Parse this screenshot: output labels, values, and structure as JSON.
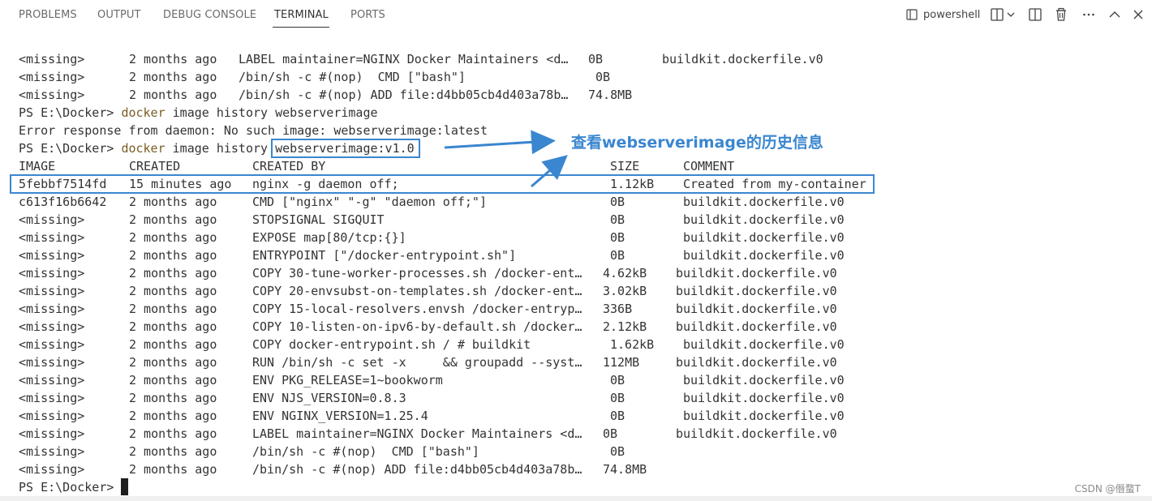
{
  "panel": {
    "tabs": [
      {
        "label": "PROBLEMS",
        "active": false
      },
      {
        "label": "OUTPUT",
        "active": false
      },
      {
        "label": "DEBUG CONSOLE",
        "active": false
      },
      {
        "label": "TERMINAL",
        "active": true
      },
      {
        "label": "PORTS",
        "active": false
      }
    ],
    "shell_label": "powershell",
    "icons": [
      "terminal-icon",
      "split-terminal-icon",
      "chevron-down-icon",
      "layout-icon",
      "trash-icon",
      "more-icon",
      "chevron-up-icon",
      "close-icon"
    ]
  },
  "terminal": {
    "lines": [
      {
        "image": "<missing>",
        "created": "2 months ago",
        "created_by": "LABEL maintainer=NGINX Docker Maintainers <d…",
        "size": "0B",
        "comment": "buildkit.dockerfile.v0"
      },
      {
        "image": "<missing>",
        "created": "2 months ago",
        "created_by": "/bin/sh -c #(nop)  CMD [\"bash\"]",
        "size": "0B",
        "comment": ""
      },
      {
        "image": "<missing>",
        "created": "2 months ago",
        "created_by": "/bin/sh -c #(nop) ADD file:d4bb05cb4d403a78b…",
        "size": "74.8MB",
        "comment": ""
      }
    ],
    "prompt1": "PS E:\\Docker> ",
    "command1": "docker image history webserverimage",
    "command1_parts": [
      "docker",
      " image history webserverimage"
    ],
    "error_line": "Error response from daemon: No such image: webserverimage:latest",
    "prompt2": "PS E:\\Docker> ",
    "command2_parts": [
      "docker",
      " image history ",
      "webserverimage:v1.0"
    ],
    "headers": {
      "image": "IMAGE",
      "created": "CREATED",
      "created_by": "CREATED BY",
      "size": "SIZE",
      "comment": "COMMENT"
    },
    "history": [
      {
        "image": "5febbf7514fd",
        "created": "15 minutes ago",
        "created_by": "nginx -g daemon off;",
        "size": "1.12kB",
        "comment": "Created from my-container"
      },
      {
        "image": "c613f16b6642",
        "created": "2 months ago",
        "created_by": "CMD [\"nginx\" \"-g\" \"daemon off;\"]",
        "size": "0B",
        "comment": "buildkit.dockerfile.v0"
      },
      {
        "image": "<missing>",
        "created": "2 months ago",
        "created_by": "STOPSIGNAL SIGQUIT",
        "size": "0B",
        "comment": "buildkit.dockerfile.v0"
      },
      {
        "image": "<missing>",
        "created": "2 months ago",
        "created_by": "EXPOSE map[80/tcp:{}]",
        "size": "0B",
        "comment": "buildkit.dockerfile.v0"
      },
      {
        "image": "<missing>",
        "created": "2 months ago",
        "created_by": "ENTRYPOINT [\"/docker-entrypoint.sh\"]",
        "size": "0B",
        "comment": "buildkit.dockerfile.v0"
      },
      {
        "image": "<missing>",
        "created": "2 months ago",
        "created_by": "COPY 30-tune-worker-processes.sh /docker-ent…",
        "size": "4.62kB",
        "comment": "buildkit.dockerfile.v0"
      },
      {
        "image": "<missing>",
        "created": "2 months ago",
        "created_by": "COPY 20-envsubst-on-templates.sh /docker-ent…",
        "size": "3.02kB",
        "comment": "buildkit.dockerfile.v0"
      },
      {
        "image": "<missing>",
        "created": "2 months ago",
        "created_by": "COPY 15-local-resolvers.envsh /docker-entryp…",
        "size": "336B",
        "comment": "buildkit.dockerfile.v0"
      },
      {
        "image": "<missing>",
        "created": "2 months ago",
        "created_by": "COPY 10-listen-on-ipv6-by-default.sh /docker…",
        "size": "2.12kB",
        "comment": "buildkit.dockerfile.v0"
      },
      {
        "image": "<missing>",
        "created": "2 months ago",
        "created_by": "COPY docker-entrypoint.sh / # buildkit",
        "size": "1.62kB",
        "comment": "buildkit.dockerfile.v0"
      },
      {
        "image": "<missing>",
        "created": "2 months ago",
        "created_by": "RUN /bin/sh -c set -x     && groupadd --syst…",
        "size": "112MB",
        "comment": "buildkit.dockerfile.v0"
      },
      {
        "image": "<missing>",
        "created": "2 months ago",
        "created_by": "ENV PKG_RELEASE=1~bookworm",
        "size": "0B",
        "comment": "buildkit.dockerfile.v0"
      },
      {
        "image": "<missing>",
        "created": "2 months ago",
        "created_by": "ENV NJS_VERSION=0.8.3",
        "size": "0B",
        "comment": "buildkit.dockerfile.v0"
      },
      {
        "image": "<missing>",
        "created": "2 months ago",
        "created_by": "ENV NGINX_VERSION=1.25.4",
        "size": "0B",
        "comment": "buildkit.dockerfile.v0"
      },
      {
        "image": "<missing>",
        "created": "2 months ago",
        "created_by": "LABEL maintainer=NGINX Docker Maintainers <d…",
        "size": "0B",
        "comment": "buildkit.dockerfile.v0"
      },
      {
        "image": "<missing>",
        "created": "2 months ago",
        "created_by": "/bin/sh -c #(nop)  CMD [\"bash\"]",
        "size": "0B",
        "comment": ""
      },
      {
        "image": "<missing>",
        "created": "2 months ago",
        "created_by": "/bin/sh -c #(nop) ADD file:d4bb05cb4d403a78b…",
        "size": "74.8MB",
        "comment": ""
      }
    ],
    "final_prompt": "PS E:\\Docker> "
  },
  "annotation": {
    "text": "查看webserverimage的历史信息",
    "color": "#3a86d0"
  },
  "watermark": "CSDN @僭蝥T"
}
